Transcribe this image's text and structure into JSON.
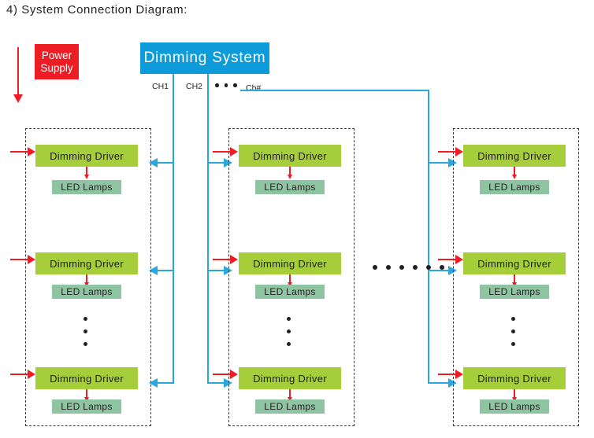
{
  "title": "4) System Connection Diagram:",
  "colors": {
    "power_red": "#ee1c25",
    "system_blue": "#0d9bd9",
    "signal_blue": "#29a8e0",
    "driver_green": "#a5ce3a",
    "lamp_green": "#8fc4a3",
    "group_dash": "#3c3c3c",
    "text_dark": "#231f20"
  },
  "power_supply": {
    "line1": "Power",
    "line2": "Supply"
  },
  "dimming_system": {
    "label": "Dimming System"
  },
  "channels": [
    {
      "id": "ch1",
      "label": "CH1"
    },
    {
      "id": "ch2",
      "label": "CH2"
    },
    {
      "id": "chn",
      "label": "Ch#"
    }
  ],
  "channel_ellipsis_dots": 3,
  "groups": [
    {
      "id": "group-ch1",
      "channel": "CH1",
      "rows": [
        {
          "driver": "Dimming Driver",
          "lamp": "LED Lamps"
        },
        {
          "driver": "Dimming Driver",
          "lamp": "LED Lamps"
        },
        {
          "driver": "Dimming Driver",
          "lamp": "LED Lamps"
        }
      ],
      "vertical_ellipsis_dots": 3
    },
    {
      "id": "group-ch2",
      "channel": "CH2",
      "rows": [
        {
          "driver": "Dimming Driver",
          "lamp": "LED Lamps"
        },
        {
          "driver": "Dimming Driver",
          "lamp": "LED Lamps"
        },
        {
          "driver": "Dimming Driver",
          "lamp": "LED Lamps"
        }
      ],
      "vertical_ellipsis_dots": 3
    },
    {
      "id": "group-chn",
      "channel": "Ch#",
      "rows": [
        {
          "driver": "Dimming Driver",
          "lamp": "LED Lamps"
        },
        {
          "driver": "Dimming Driver",
          "lamp": "LED Lamps"
        },
        {
          "driver": "Dimming Driver",
          "lamp": "LED Lamps"
        }
      ],
      "vertical_ellipsis_dots": 3
    }
  ],
  "group_ellipsis_dots": 6
}
